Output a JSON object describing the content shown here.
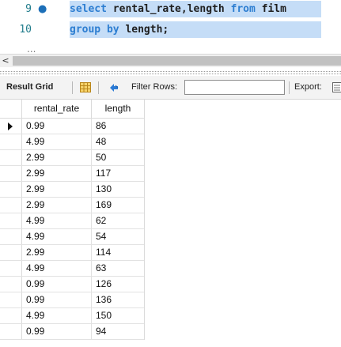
{
  "editor": {
    "lines": [
      {
        "number": "9",
        "marker": "●",
        "tokens": [
          {
            "text": "select",
            "kind": "kw"
          },
          {
            "text": " rental_rate,length ",
            "kind": "plain"
          },
          {
            "text": "from",
            "kind": "kw"
          },
          {
            "text": " film",
            "kind": "plain"
          }
        ]
      },
      {
        "number": "10",
        "marker": "",
        "tokens": [
          {
            "text": "group by",
            "kind": "kw"
          },
          {
            "text": " length;",
            "kind": "plain"
          }
        ]
      }
    ],
    "overflow_marker": "..."
  },
  "scrollbar": {
    "left_arrow": "<"
  },
  "toolbar": {
    "result_grid_label": "Result Grid",
    "filter_label": "Filter Rows:",
    "filter_value": "",
    "export_label": "Export:"
  },
  "grid": {
    "columns": [
      "rental_rate",
      "length"
    ],
    "rows": [
      [
        "0.99",
        "86"
      ],
      [
        "4.99",
        "48"
      ],
      [
        "2.99",
        "50"
      ],
      [
        "2.99",
        "117"
      ],
      [
        "2.99",
        "130"
      ],
      [
        "2.99",
        "169"
      ],
      [
        "4.99",
        "62"
      ],
      [
        "4.99",
        "54"
      ],
      [
        "2.99",
        "114"
      ],
      [
        "4.99",
        "63"
      ],
      [
        "0.99",
        "126"
      ],
      [
        "0.99",
        "136"
      ],
      [
        "4.99",
        "150"
      ],
      [
        "0.99",
        "94"
      ]
    ],
    "selected_row": 0
  },
  "colors": {
    "keyword": "#2d7ed1",
    "selection": "#c5ddf7",
    "line_number": "#227d8c"
  },
  "icons": [
    "grid-view-icon",
    "refresh-icon",
    "export-icon"
  ]
}
